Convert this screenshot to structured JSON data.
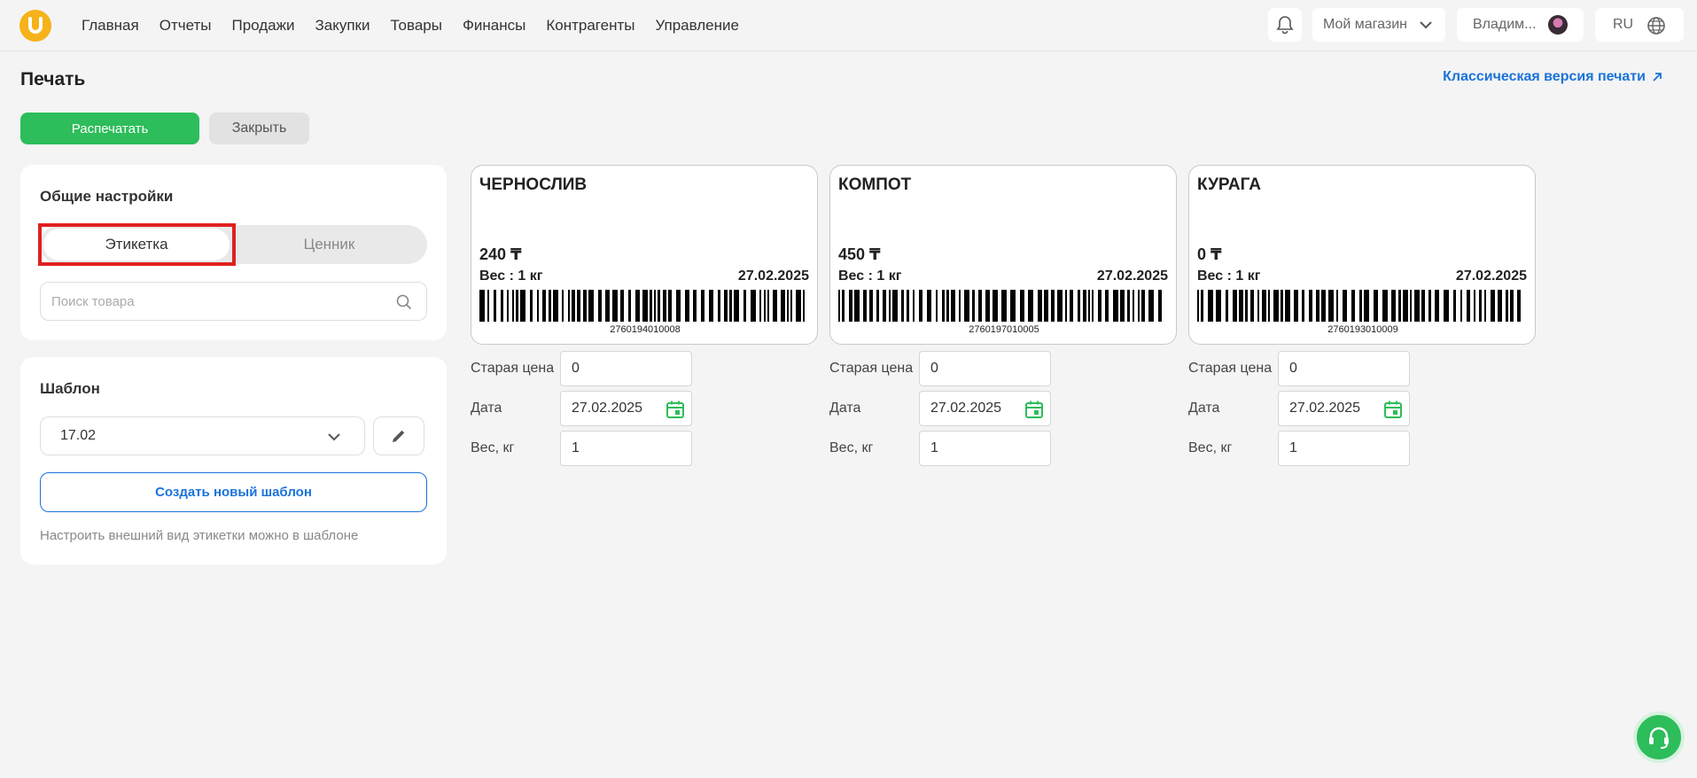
{
  "nav": {
    "items": [
      "Главная",
      "Отчеты",
      "Продажи",
      "Закупки",
      "Товары",
      "Финансы",
      "Контрагенты",
      "Управление"
    ]
  },
  "header": {
    "store": "Мой магазин",
    "user": "Владим...",
    "lang": "RU"
  },
  "page": {
    "title": "Печать",
    "classic_link": "Классическая версия печати",
    "print_button": "Распечатать",
    "close_button": "Закрыть"
  },
  "general": {
    "heading": "Общие настройки",
    "seg_label": "Этикетка",
    "seg_price_tag": "Ценник",
    "selected": "Этикетка",
    "search_placeholder": "Поиск товара"
  },
  "template": {
    "heading": "Шаблон",
    "selected": "17.02",
    "create_button": "Создать новый шаблон",
    "hint": "Настроить внешний вид этикетки можно в шаблоне"
  },
  "field_labels": {
    "old_price": "Старая цена",
    "date": "Дата",
    "weight": "Вес, кг"
  },
  "labels": [
    {
      "name": "ЧЕРНОСЛИВ",
      "price": "240 ₸",
      "weight": "Вес : 1 кг",
      "date": "27.02.2025",
      "barcode": "2760194010008",
      "old_price": "0",
      "date_input": "27.02.2025",
      "weight_input": "1"
    },
    {
      "name": "КОМПОТ",
      "price": "450 ₸",
      "weight": "Вес : 1 кг",
      "date": "27.02.2025",
      "barcode": "2760197010005",
      "old_price": "0",
      "date_input": "27.02.2025",
      "weight_input": "1"
    },
    {
      "name": "КУРАГА",
      "price": "0 ₸",
      "weight": "Вес : 1 кг",
      "date": "27.02.2025",
      "barcode": "2760193010009",
      "old_price": "0",
      "date_input": "27.02.2025",
      "weight_input": "1"
    }
  ],
  "colors": {
    "accent_green": "#2dbd5a",
    "link_blue": "#1a73d9",
    "highlight_red": "#e0201f",
    "logo_yellow": "#f6b21a"
  },
  "icons": [
    "logo-icon",
    "bell-icon",
    "chevron-down-icon",
    "avatar",
    "globe-icon",
    "external-link-icon",
    "search-icon",
    "pencil-icon",
    "calendar-icon",
    "headset-icon"
  ]
}
